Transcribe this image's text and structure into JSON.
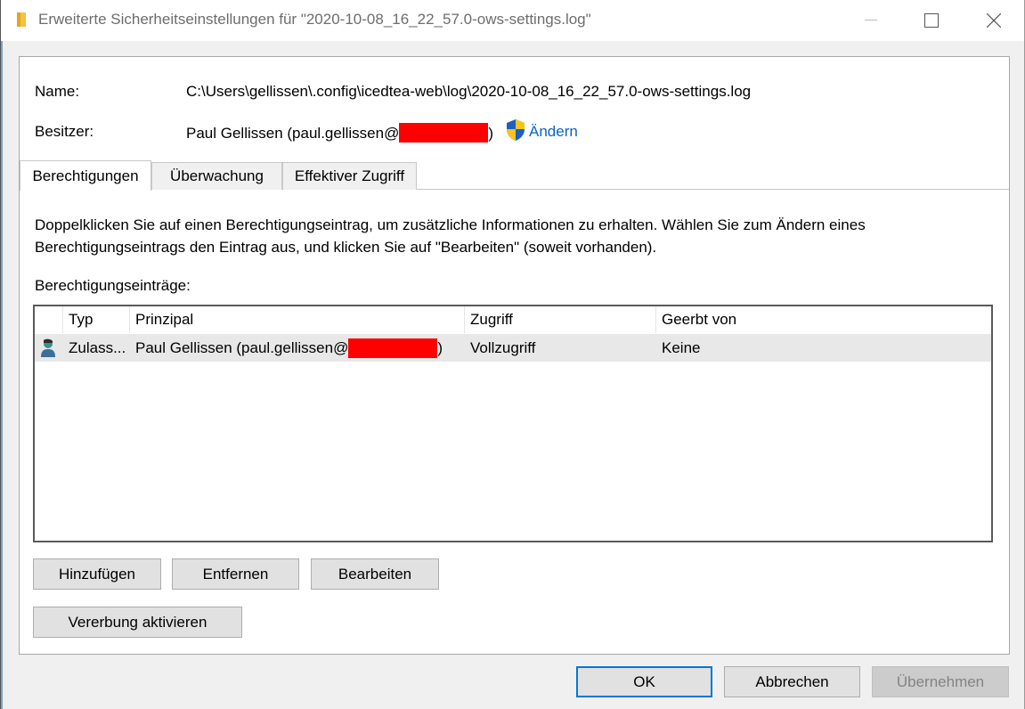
{
  "window": {
    "title": "Erweiterte Sicherheitseinstellungen für \"2020-10-08_16_22_57.0-ows-settings.log\""
  },
  "info": {
    "name_label": "Name:",
    "name_value": "C:\\Users\\gellissen\\.config\\icedtea-web\\log\\2020-10-08_16_22_57.0-ows-settings.log",
    "owner_label": "Besitzer:",
    "owner_value_prefix": "Paul Gellissen (paul.gellissen@",
    "owner_value_suffix": ")",
    "change_link": "Ändern"
  },
  "tabs": [
    {
      "label": "Berechtigungen",
      "active": true
    },
    {
      "label": "Überwachung",
      "active": false
    },
    {
      "label": "Effektiver Zugriff",
      "active": false
    }
  ],
  "description": {
    "line1": "Doppelklicken Sie auf einen Berechtigungseintrag, um zusätzliche Informationen zu erhalten. Wählen Sie zum Ändern eines",
    "line2": "Berechtigungseintrags den Eintrag aus, und klicken Sie auf \"Bearbeiten\" (soweit vorhanden)."
  },
  "entries_label": "Berechtigungseinträge:",
  "table": {
    "columns": [
      "Typ",
      "Prinzipal",
      "Zugriff",
      "Geerbt von"
    ],
    "rows": [
      {
        "type": "Zulass...",
        "principal_prefix": "Paul Gellissen (paul.gellissen@",
        "principal_suffix": ")",
        "access": "Vollzugriff",
        "inherited_from": "Keine"
      }
    ]
  },
  "buttons": {
    "add": "Hinzufügen",
    "remove": "Entfernen",
    "edit": "Bearbeiten",
    "enable_inheritance": "Vererbung aktivieren"
  },
  "footer": {
    "ok": "OK",
    "cancel": "Abbrechen",
    "apply": "Übernehmen"
  },
  "colors": {
    "link": "#0a64c2",
    "redaction": "#ff0000",
    "focus_border": "#0078d7"
  }
}
